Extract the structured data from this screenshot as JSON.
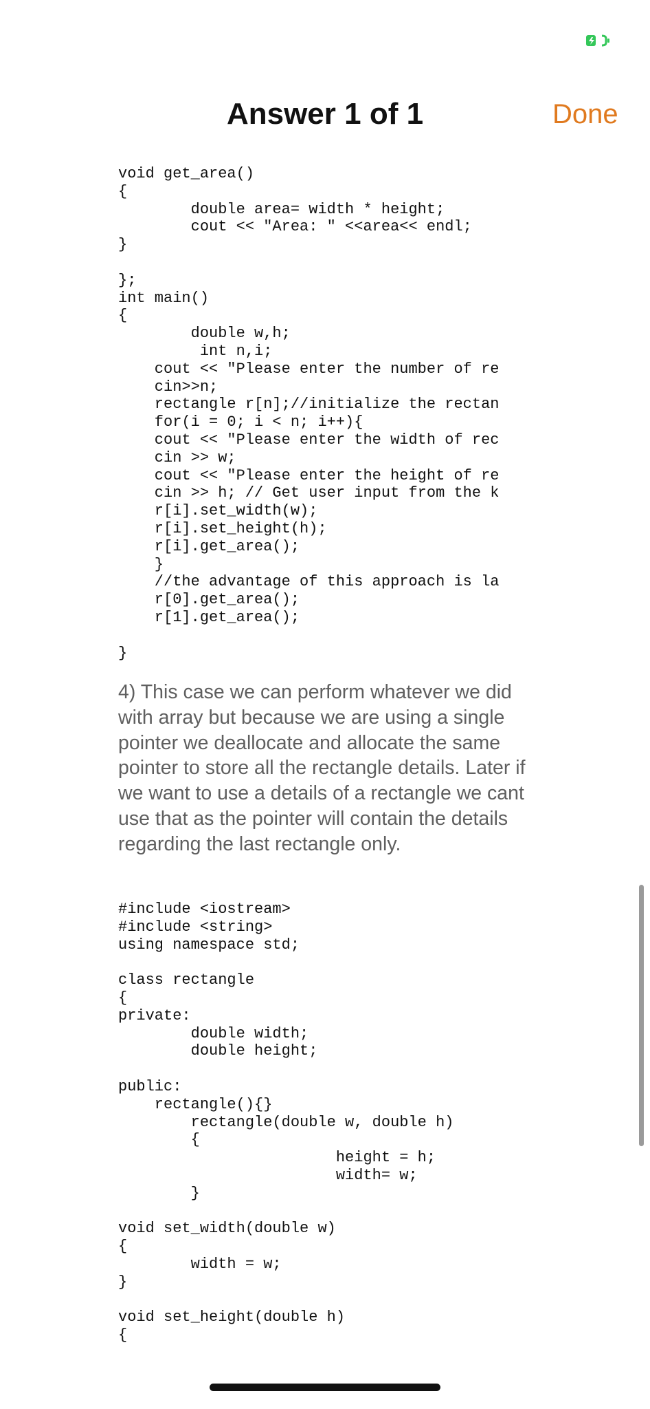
{
  "status_bar": {
    "battery_icon": "battery-charging-icon",
    "battery_color": "#34c759"
  },
  "header": {
    "title": "Answer 1 of 1",
    "done_label": "Done",
    "accent_color": "#e07a1f"
  },
  "content": {
    "code_block_1": "void get_area()\n{\n        double area= width * height;\n        cout << \"Area: \" <<area<< endl;\n}\n\n};\nint main()\n{\n        double w,h;\n         int n,i;\n    cout << \"Please enter the number of re\n    cin>>n;\n    rectangle r[n];//initialize the rectan\n    for(i = 0; i < n; i++){\n    cout << \"Please enter the width of rec\n    cin >> w;\n    cout << \"Please enter the height of re\n    cin >> h; // Get user input from the k\n    r[i].set_width(w);\n    r[i].set_height(h);\n    r[i].get_area();\n    }\n    //the advantage of this approach is la\n    r[0].get_area();\n    r[1].get_area();\n\n}",
    "paragraph": "4) This case we can perform whatever we did with array but because we are using a single pointer we deallocate and allocate the same pointer to store all the rectangle details. Later if we want to use a details of a rectangle we cant use that as the pointer will contain the details regarding the last rectangle only.",
    "code_block_2": "#include <iostream>\n#include <string>\nusing namespace std;\n\nclass rectangle\n{\nprivate:\n        double width;\n        double height;\n\npublic:\n    rectangle(){}\n        rectangle(double w, double h)\n        {\n                        height = h;\n                        width= w;\n        }\n\nvoid set_width(double w)\n{\n        width = w;\n}\n\nvoid set_height(double h)\n{"
  },
  "scrollbar": {
    "position_fraction": 0.72
  }
}
